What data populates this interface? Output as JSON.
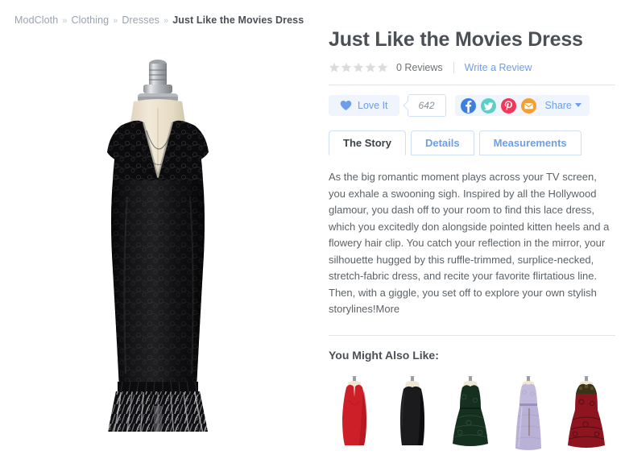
{
  "breadcrumb": {
    "items": [
      {
        "label": "ModCloth",
        "current": false
      },
      {
        "label": "Clothing",
        "current": false
      },
      {
        "label": "Dresses",
        "current": false
      },
      {
        "label": "Just Like the Movies Dress",
        "current": true
      }
    ],
    "separator": "»"
  },
  "product": {
    "title": "Just Like the Movies Dress",
    "image_alt": "Black lace midi dress with ruffled hem on mannequin",
    "rating": {
      "stars_total": 5,
      "stars_filled": 0,
      "reviews_text": "0 Reviews",
      "write_review_label": "Write a Review"
    }
  },
  "social": {
    "love_label": "Love It",
    "love_count": "642",
    "share_label": "Share",
    "icons": [
      {
        "name": "facebook-share-icon",
        "glyph": "f",
        "color": "#3b7fe0"
      },
      {
        "name": "twitter-share-icon",
        "glyph": "t",
        "color": "#5ccfc8"
      },
      {
        "name": "pinterest-share-icon",
        "glyph": "P",
        "color": "#f0385b"
      },
      {
        "name": "email-share-icon",
        "glyph": "✉",
        "color": "#f5a02e"
      }
    ]
  },
  "tabs": [
    {
      "label": "The Story",
      "active": true
    },
    {
      "label": "Details",
      "active": false
    },
    {
      "label": "Measurements",
      "active": false
    }
  ],
  "story": {
    "text": "As the big romantic moment plays across your TV screen, you exhale a swooning sigh. Inspired by all the Hollywood glamour, you dash off to your room to find this lace dress, which you excitedly don alongside pointed kitten heels and a flowery hair clip. You catch your reflection in the mirror, your silhouette hugged by this ruffle-trimmed, surplice-necked, stretch-fabric dress, and recite your favorite flirtatious line. Then, with a giggle, you set off to explore your own stylish storylines!",
    "more_label": "More"
  },
  "recommendations": {
    "title": "You Might Also Like:",
    "items": [
      {
        "name": "red-sheath-dress",
        "body": "#cc1f28",
        "shadow": "#9a1118",
        "style": "sheath"
      },
      {
        "name": "black-sheath-dress",
        "body": "#1b1b1e",
        "shadow": "#000000",
        "style": "sheath"
      },
      {
        "name": "green-lace-dress",
        "body": "#16301f",
        "shadow": "#0a1a11",
        "style": "flare"
      },
      {
        "name": "lavender-gown-dress",
        "body": "#b9b1d6",
        "shadow": "#9a92bd",
        "style": "gown"
      },
      {
        "name": "red-black-lace-dress",
        "body": "#8e1520",
        "shadow": "#4d0a10",
        "style": "flare"
      }
    ]
  },
  "colors": {
    "link_blue": "#6d9eeb",
    "text_dark": "#4a5056",
    "text_body": "#5c6368",
    "star_empty": "#dcdcdc",
    "panel_tint": "#eff4fd"
  }
}
